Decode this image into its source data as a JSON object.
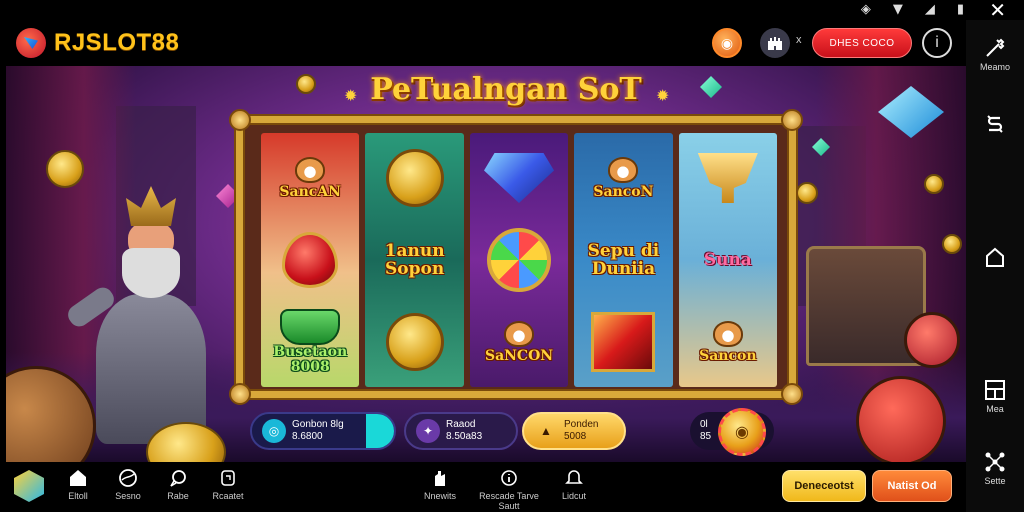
{
  "app": {
    "logo_text": "RJSLOT88",
    "game_title": "PeTualngan SoT"
  },
  "topbar": {
    "red_button_label": "DHES COCO",
    "info_label": "i",
    "x_label": "x"
  },
  "rightnav": {
    "items": [
      {
        "label": "Meamo",
        "icon": "wand-icon"
      },
      {
        "label": "",
        "icon": "s-logo-icon"
      },
      {
        "label": "",
        "icon": "home-icon"
      },
      {
        "label": "Mea",
        "icon": "layout-icon"
      },
      {
        "label": "Sette",
        "icon": "share-icon"
      }
    ]
  },
  "reels": [
    [
      {
        "text": "SancAN",
        "shape": "dog"
      },
      {
        "text": "",
        "shape": "heart"
      },
      {
        "text": "Busetaon 8008",
        "shape": "pot"
      }
    ],
    [
      {
        "text": "",
        "shape": "coin"
      },
      {
        "text": "1anun Sopon",
        "shape": "none"
      },
      {
        "text": "",
        "shape": "coin"
      }
    ],
    [
      {
        "text": "",
        "shape": "gem"
      },
      {
        "text": "",
        "shape": "wheel"
      },
      {
        "text": "SaNCON",
        "shape": "dog"
      }
    ],
    [
      {
        "text": "SancoN",
        "shape": "dog"
      },
      {
        "text": "Sepu di Duniia",
        "shape": "none"
      },
      {
        "text": "",
        "shape": "square"
      }
    ],
    [
      {
        "text": "",
        "shape": "trophy"
      },
      {
        "text": "Suna",
        "shape": "none"
      },
      {
        "text": "Sancon",
        "shape": "dog"
      }
    ]
  ],
  "controls": {
    "balance_label": "Gonbon 8lg",
    "balance_value": "8.6800",
    "bet_label": "Raaod",
    "bet_value": "8.50a83",
    "action_label": "Ponden",
    "action_value": "5008",
    "small_1": "0l",
    "small_2": "85"
  },
  "bottombar": {
    "items": [
      {
        "label": "Eltoll",
        "icon": "home-icon"
      },
      {
        "label": "Sesno",
        "icon": "globe-icon"
      },
      {
        "label": "Rabe",
        "icon": "chat-icon"
      },
      {
        "label": "Rcaatet",
        "icon": "frame-icon"
      },
      {
        "label": "Nnewits",
        "icon": "hand-icon"
      },
      {
        "label": "Rescade Tarve Sautt",
        "icon": "info-circle-icon"
      },
      {
        "label": "Lidcut",
        "icon": "bell-icon"
      }
    ],
    "button_yellow": "Deneceotst",
    "button_orange": "Natist Od"
  }
}
